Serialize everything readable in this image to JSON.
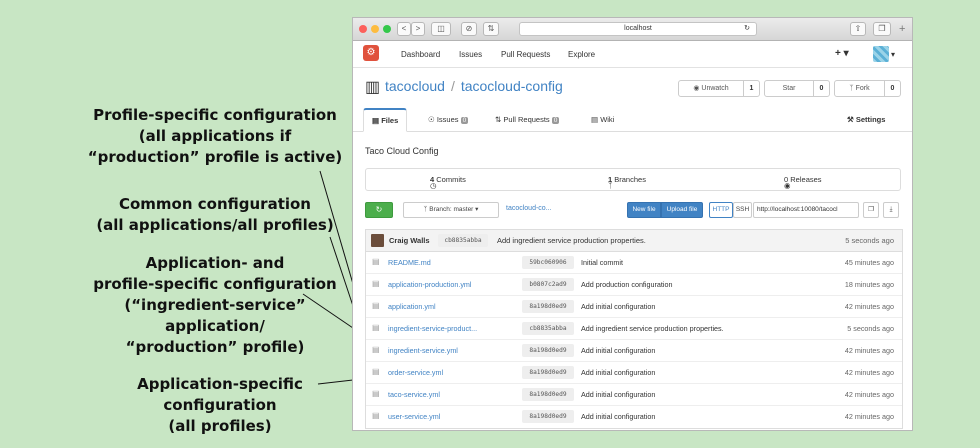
{
  "annotations": {
    "profile_specific": [
      "Profile-specific configuration",
      "(all applications if",
      "“production” profile is active)"
    ],
    "common": [
      "Common configuration",
      "(all applications/all profiles)"
    ],
    "app_and_profile": [
      "Application- and",
      "profile-specific configuration",
      "(“ingredient-service”",
      "application/",
      "“production” profile)"
    ],
    "app_specific": [
      "Application-specific",
      "configuration",
      "(all profiles)"
    ]
  },
  "browser": {
    "url": "localhost",
    "back": "<",
    "forward": ">"
  },
  "nav": {
    "logo_glyph": "⚙",
    "links": [
      "Dashboard",
      "Issues",
      "Pull Requests",
      "Explore"
    ],
    "plus": "+ ▾",
    "avatar_caret": "▾"
  },
  "repo": {
    "owner": "tacocloud",
    "separator": "/",
    "name": "tacocloud-config",
    "unwatch_label": "Unwatch",
    "unwatch_count": "1",
    "star_label": "Star",
    "star_count": "0",
    "fork_label": "Fork",
    "fork_count": "0"
  },
  "tabs": {
    "files": "Files",
    "issues": "Issues",
    "issues_count": "0",
    "pulls": "Pull Requests",
    "pulls_count": "0",
    "wiki": "Wiki",
    "settings": "Settings"
  },
  "description": "Taco Cloud Config",
  "stats": {
    "commits_num": "4",
    "commits_label": "Commits",
    "branches_num": "1",
    "branches_label": "Branches",
    "releases_num": "0",
    "releases_label": "Releases"
  },
  "toolbar": {
    "branch_label": "Branch:",
    "branch_value": "master",
    "path": "tacocloud-co...",
    "new_file": "New file",
    "upload_file": "Upload file",
    "http": "HTTP",
    "ssh": "SSH",
    "clone_url": "http://localhost:10080/tacocl"
  },
  "latest_commit": {
    "author": "Craig Walls",
    "sha": "cb8835abba",
    "message": "Add ingredient service production properties.",
    "age": "5 seconds ago"
  },
  "files": [
    {
      "name": "README.md",
      "sha": "59bc060906",
      "message": "Initial commit",
      "age": "45 minutes ago"
    },
    {
      "name": "application-production.yml",
      "sha": "b0807c2ad9",
      "message": "Add production configuration",
      "age": "18 minutes ago"
    },
    {
      "name": "application.yml",
      "sha": "8a198d0ed9",
      "message": "Add initial configuration",
      "age": "42 minutes ago"
    },
    {
      "name": "ingredient-service-product...",
      "sha": "cb8835abba",
      "message": "Add ingredient service production properties.",
      "age": "5 seconds ago"
    },
    {
      "name": "ingredient-service.yml",
      "sha": "8a198d0ed9",
      "message": "Add initial configuration",
      "age": "42 minutes ago"
    },
    {
      "name": "order-service.yml",
      "sha": "8a198d0ed9",
      "message": "Add initial configuration",
      "age": "42 minutes ago"
    },
    {
      "name": "taco-service.yml",
      "sha": "8a198d0ed9",
      "message": "Add initial configuration",
      "age": "42 minutes ago"
    },
    {
      "name": "user-service.yml",
      "sha": "8a198d0ed9",
      "message": "Add initial configuration",
      "age": "42 minutes ago"
    }
  ],
  "colors": {
    "background": "#c8e6c4",
    "link": "#4183c4",
    "brand": "#e0523d",
    "primary_button": "#4183c4",
    "green_button": "#4cae4c"
  }
}
